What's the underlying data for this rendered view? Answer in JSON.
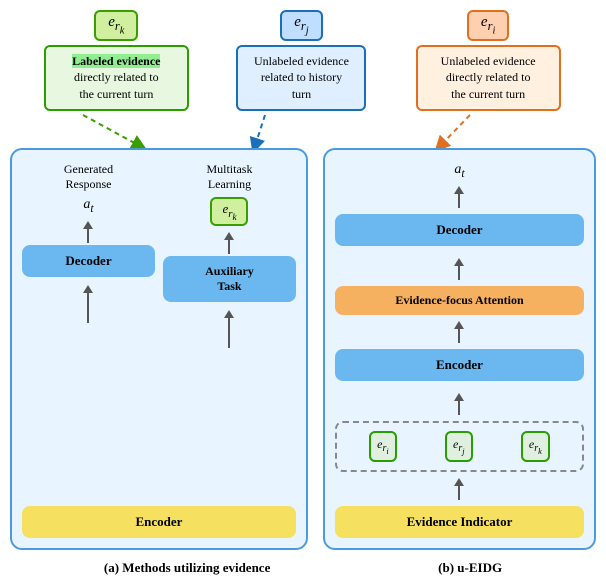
{
  "top": {
    "label_k": "e_{r_k}",
    "label_j": "e_{r_j}",
    "label_i": "e_{r_i}",
    "box_green_text": "Labeled evidence directly related to the current turn",
    "box_blue_text": "Unlabeled evidence related to history turn",
    "box_orange_text": "Unlabeled evidence directly related to the current turn"
  },
  "panel_a": {
    "title": "(a) Methods utilizing evidence",
    "col1_title": "Generated\nResponse",
    "col2_title": "Multitask\nLearning",
    "at_label": "a_t",
    "er_label": "e_{r_k}",
    "decoder_label": "Decoder",
    "auxiliary_task_label": "Auxiliary\nTask",
    "encoder_label": "Encoder"
  },
  "panel_b": {
    "title": "(b) u-EIDG",
    "at_label": "a_t",
    "decoder_label": "Decoder",
    "attention_label": "Evidence-focus Attention",
    "encoder_label": "Encoder",
    "evidence_i": "e_{r_i}",
    "evidence_j": "e_{r_j}",
    "evidence_k": "e_{r_k}",
    "indicator_label": "Evidence Indicator"
  }
}
